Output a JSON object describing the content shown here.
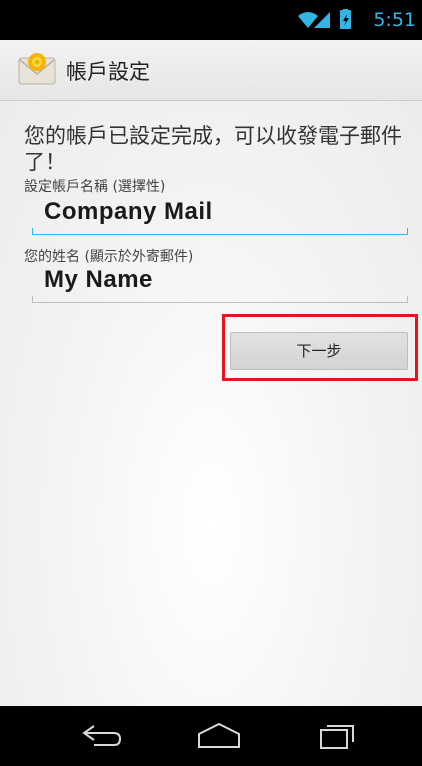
{
  "status_bar": {
    "time": "5:51",
    "icons": [
      "wifi-icon",
      "signal-icon",
      "battery-icon"
    ],
    "accent_color": "#33b5e5"
  },
  "action_bar": {
    "title": "帳戶設定",
    "icon": "email-app-icon"
  },
  "content": {
    "headline": "您的帳戶已設定完成，可以收發電子郵件了！",
    "account_name": {
      "label": "設定帳戶名稱 (選擇性)",
      "value": "Company Mail"
    },
    "your_name": {
      "label": "您的姓名 (顯示於外寄郵件)",
      "value": "My Name"
    },
    "next_label": "下一步"
  },
  "nav_bar": {
    "buttons": [
      "back-icon",
      "home-icon",
      "recent-apps-icon"
    ]
  },
  "colors": {
    "focus_underline": "#33b5e5",
    "highlight": "#e8141c"
  }
}
